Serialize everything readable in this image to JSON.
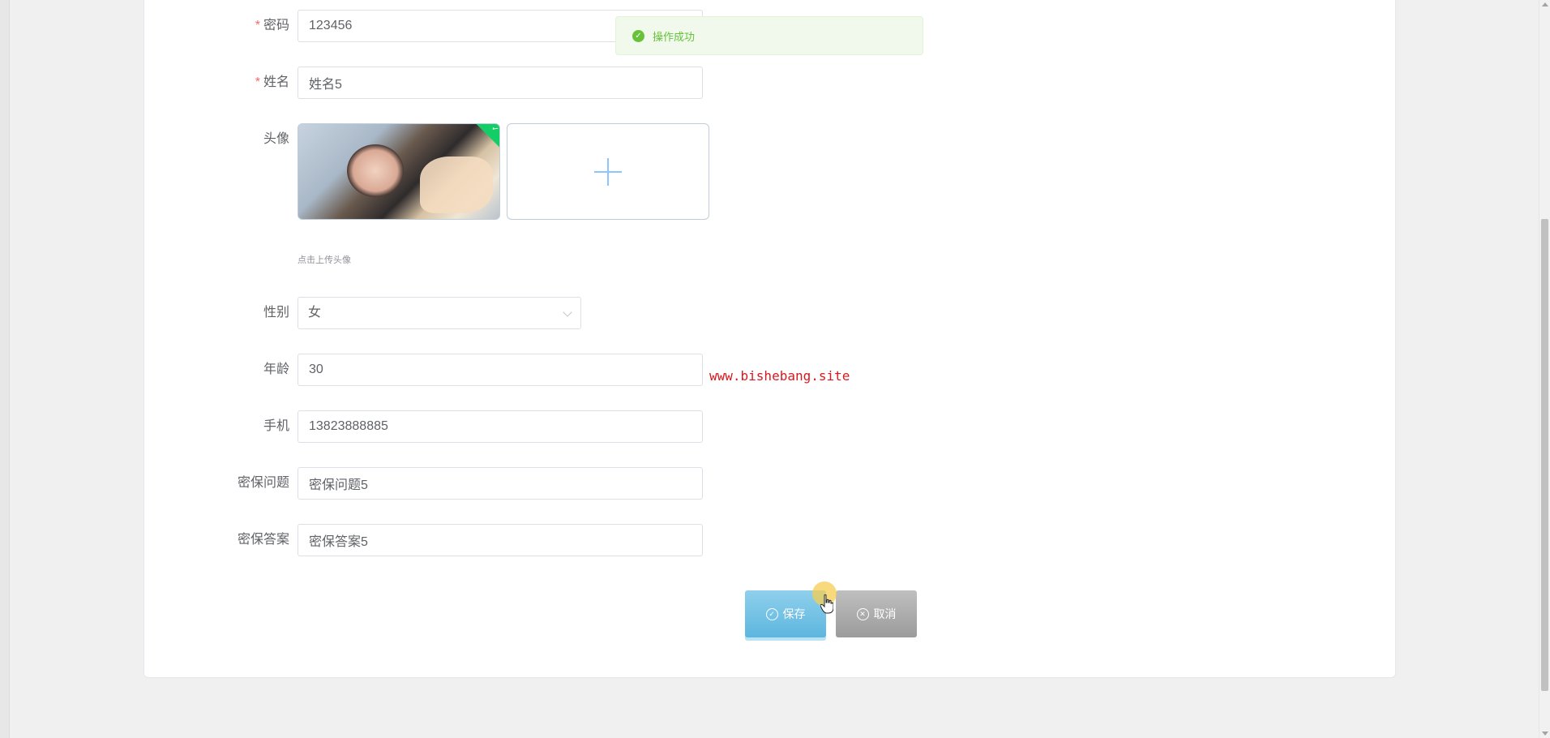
{
  "toast": {
    "message": "操作成功"
  },
  "form": {
    "password": {
      "label": "密码",
      "required_mark": "*",
      "value": "123456"
    },
    "name": {
      "label": "姓名",
      "required_mark": "*",
      "value": "姓名5"
    },
    "avatar": {
      "label": "头像",
      "hint": "点击上传头像"
    },
    "gender": {
      "label": "性别",
      "value": "女"
    },
    "age": {
      "label": "年龄",
      "value": "30"
    },
    "phone": {
      "label": "手机",
      "value": "13823888885"
    },
    "security_question": {
      "label": "密保问题",
      "value": "密保问题5"
    },
    "security_answer": {
      "label": "密保答案",
      "value": "密保答案5"
    }
  },
  "watermark": "www.bishebang.site",
  "buttons": {
    "save": "保存",
    "cancel": "取消"
  },
  "colors": {
    "accent_save": "#5db6df",
    "cancel": "#9b9b9b",
    "success": "#67c23a",
    "required": "#f56c6c",
    "watermark": "#d9181e"
  }
}
